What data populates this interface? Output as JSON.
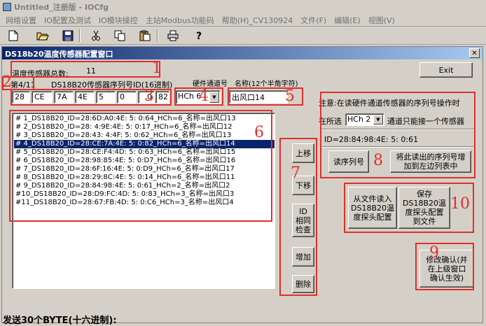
{
  "app": {
    "title": "Untitled_注册版 - IOCfg",
    "menu": [
      "网络设置",
      "IO配置及测试",
      "IO模块操控",
      "主站Modbus功能码",
      "帮助(H)_CV130924",
      "文件(F)",
      "编辑(E)",
      "视图(V)"
    ],
    "toolbar_icons": [
      "new-icon",
      "open-icon",
      "save-icon",
      "cut-icon",
      "copy-icon",
      "paste-icon",
      "print-icon",
      "help-icon"
    ]
  },
  "dialog": {
    "title": "DS18b20温度传感器配置窗口",
    "close_glyph": "✕",
    "sensor_total_label": "温度传感器总数:",
    "sensor_total_value": "11",
    "exit_label": "Exit",
    "index_label": "第4/11",
    "serial_label": "DS18B20传感器序列号ID(16进制)",
    "serial_bytes": [
      "28",
      "CE",
      "7A",
      "4E",
      "5",
      "0",
      "0",
      "82"
    ],
    "hw_channel_label": "硬件通道号",
    "hw_channel_value": "HCh 6",
    "name_label": "名称(12个半角字符)",
    "name_value": "出风口14",
    "list_items": [
      "# 1_DS18B20_ID=28:6D:A0:4E: 5: 0:64_HCh=6_名称=出风口13",
      "# 2_DS18B20_ID=28: 4:9E:4E: 5: 0:17_HCh=6_名称=出风口12",
      "# 3_DS18B20_ID=28:43: 4:4F: 5: 0:62_HCh=6_名称=出风口13",
      "# 4_DS18B20_ID=28:CE:7A:4E: 5: 0:82_HCh=6_名称=出风口14",
      "# 5_DS18B20_ID=28:CE:F4:4D: 5: 0:63_HCh=6_名称=出风口15",
      "# 6_DS18B20_ID=28:98:85:4E: 5: 0:D7_HCh=6_名称=出风口16",
      "# 7_DS18B20_ID=28:6F:16:4E: 5: 0:D9_HCh=6_名称=出风口17",
      "# 8_DS18B20_ID=28:29:8C:4E: 5: 0:14_HCh=6_名称=出风口11",
      "# 9_DS18B20_ID=28:84:98:4E: 5: 0:61_HCh=2_名称=出风口2",
      "#10_DS18B20_ID=28:D9:FC:4D: 5: 0:83_HCh=3_名称=出风口3",
      "#11_DS18B20_ID=28:67:FB:4D: 5: 0:C6_HCh=3_名称=出风口4"
    ],
    "selected_index": 3,
    "buttons_side": {
      "up": "上移",
      "down": "下移",
      "check": "ID\n相同\n检查",
      "add": "增加",
      "delete": "删除"
    },
    "note": "注意:在读硬件通道传感器的序列号操作时",
    "selected_channel_prefix": "在所选",
    "selected_channel_value": "HCh 2",
    "selected_channel_suffix": "通道只能接一个传感器",
    "read_id_value": "ID=28:84:98:4E: 5: 0:61",
    "read_serial_button": "读序列号",
    "add_read_button": "将此读出的序列号增\n加到左边列表中",
    "load_file_button": "从文件读入\nDS18B20温\n度探头配置",
    "save_file_button": "保存\nDS18B20温\n度探头配置\n到文件",
    "confirm_button": "修改确认(并\n在上级窗口\n确认生效)"
  },
  "annotations": [
    "1",
    "2",
    "3",
    "4",
    "5",
    "6",
    "7",
    "8",
    "9",
    "10"
  ],
  "bottom_text": "发送30个BYTE(十六进制):"
}
